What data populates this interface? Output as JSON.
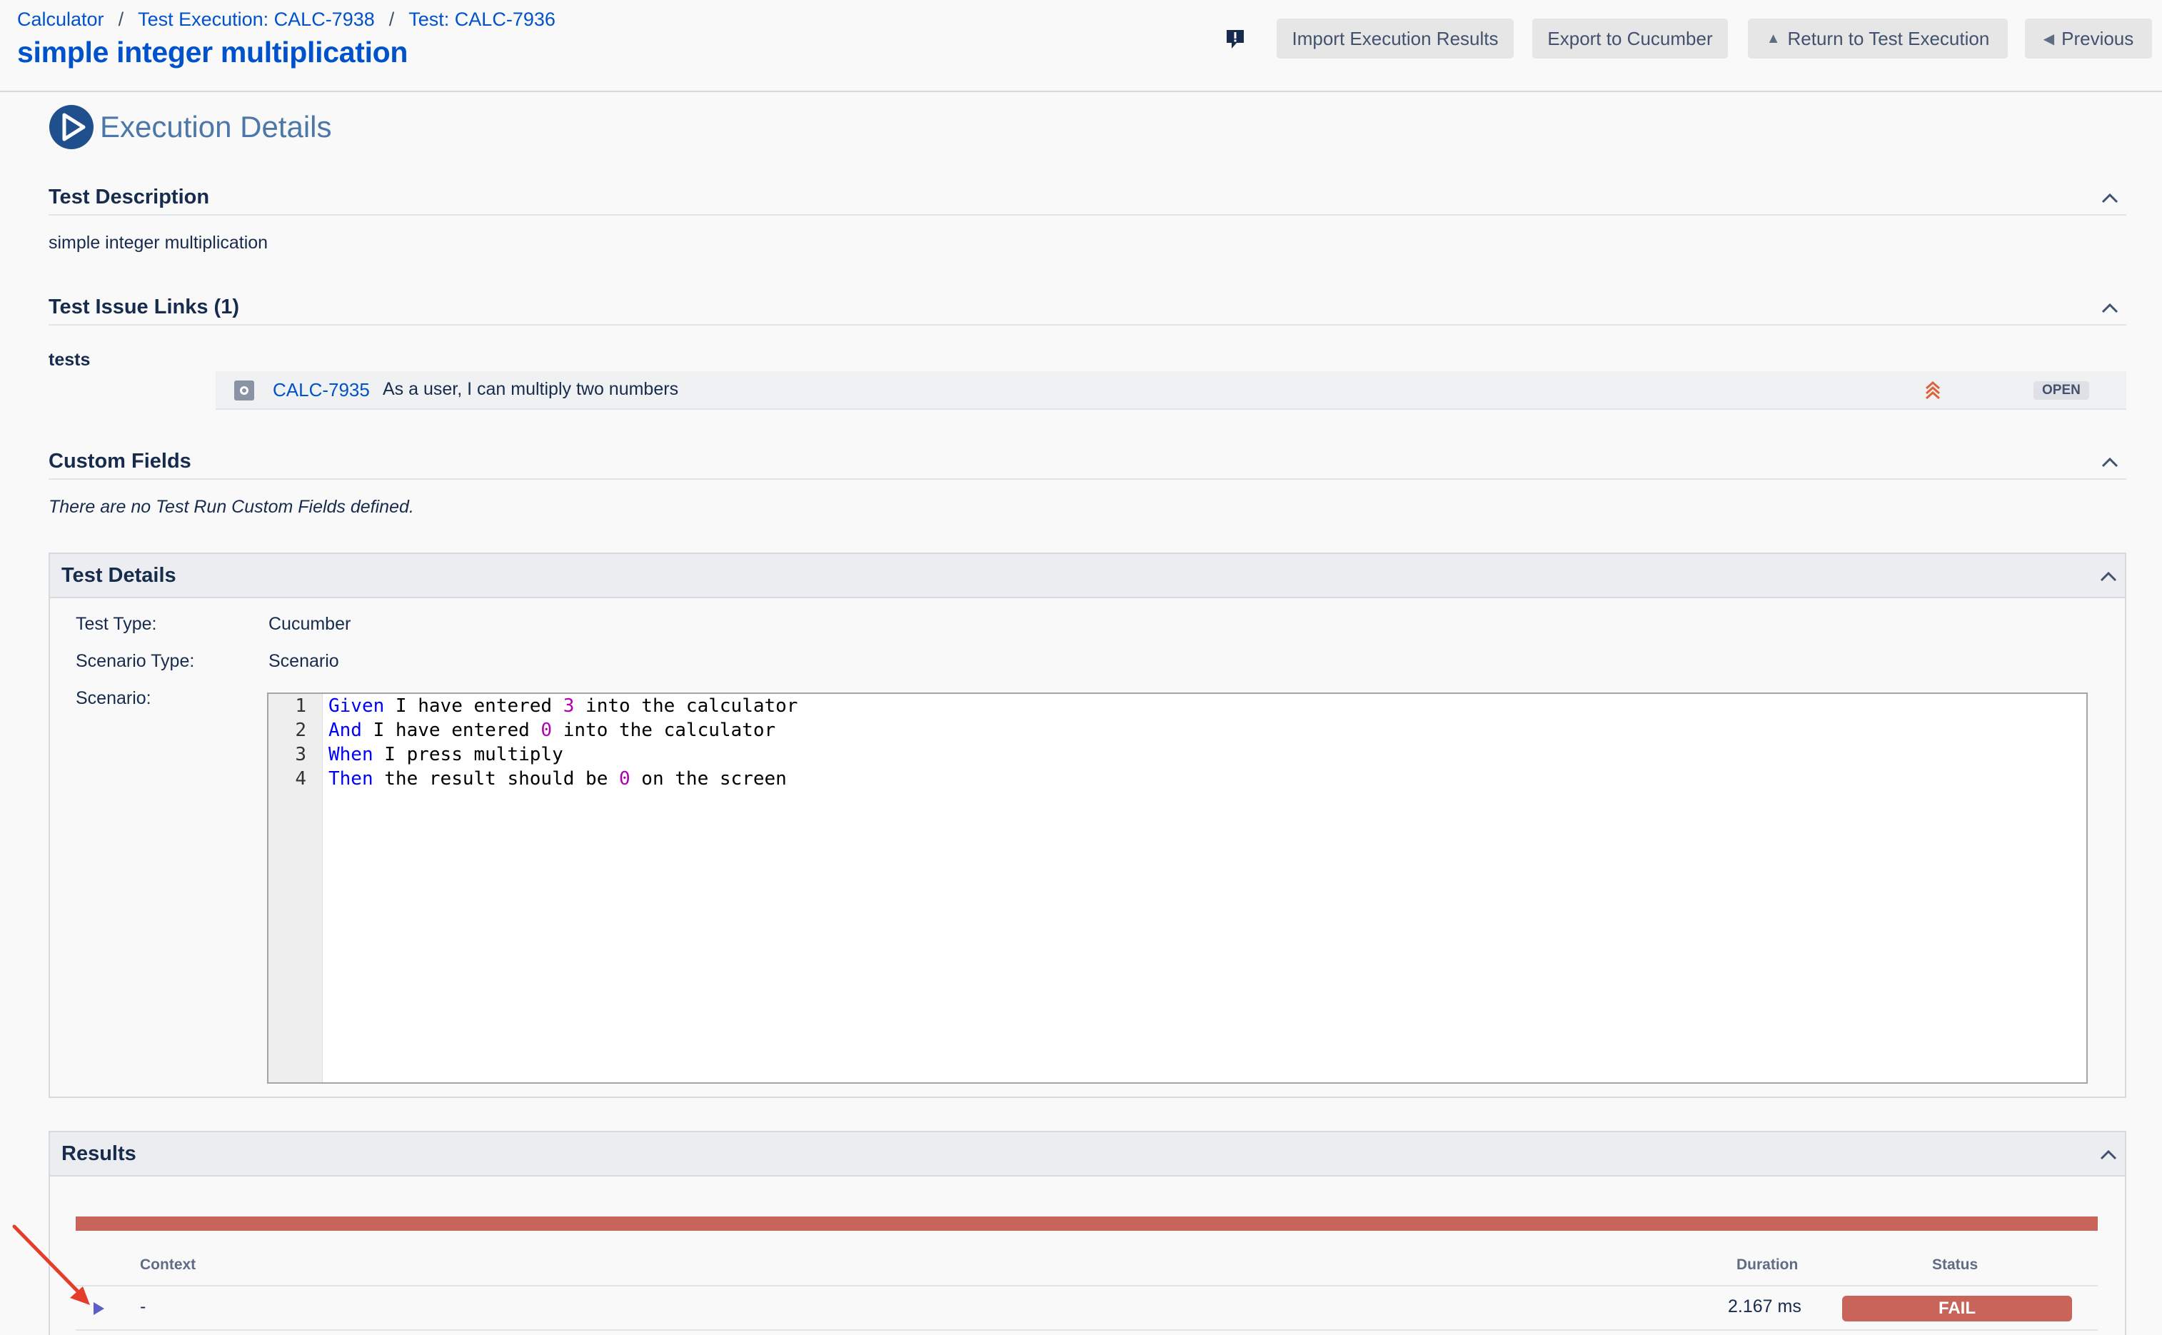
{
  "breadcrumb": [
    "Calculator",
    "Test Execution: CALC-7938",
    "Test: CALC-7936"
  ],
  "page_title": "simple integer multiplication",
  "toolbar": {
    "import": "Import Execution Results",
    "export": "Export to Cucumber",
    "return": "Return to Test Execution",
    "previous": "Previous"
  },
  "icons": {
    "feedback": "feedback-icon",
    "execution": "play-circle-icon",
    "collapse": "chevron-up-icon",
    "issue_type": "issue-type-icon",
    "priority": "priority-highest-icon",
    "expand": "play-triangle-icon"
  },
  "execution_title": "Execution Details",
  "sections": {
    "description": {
      "title": "Test Description",
      "text": "simple integer multiplication"
    },
    "issue_links": {
      "title": "Test Issue Links (1)",
      "relation": "tests",
      "items": [
        {
          "key": "CALC-7935",
          "summary": "As a user, I can multiply two numbers",
          "status": "OPEN"
        }
      ]
    },
    "custom_fields": {
      "title": "Custom Fields",
      "text": "There are no Test Run Custom Fields defined."
    }
  },
  "test_details": {
    "title": "Test Details",
    "test_type_label": "Test Type:",
    "test_type": "Cucumber",
    "scenario_type_label": "Scenario Type:",
    "scenario_type": "Scenario",
    "scenario_label": "Scenario:",
    "scenario_lines": [
      {
        "n": "1",
        "kw": "Given",
        "pre": " I have entered ",
        "num": "3",
        "post": " into the calculator"
      },
      {
        "n": "2",
        "kw": "And",
        "pre": " I have entered ",
        "num": "0",
        "post": " into the calculator"
      },
      {
        "n": "3",
        "kw": "When",
        "pre": " I press multiply",
        "num": "",
        "post": ""
      },
      {
        "n": "4",
        "kw": "Then",
        "pre": " the result should be ",
        "num": "0",
        "post": " on the screen"
      }
    ]
  },
  "results": {
    "title": "Results",
    "columns": {
      "context": "Context",
      "duration": "Duration",
      "status": "Status"
    },
    "rows": [
      {
        "context": "-",
        "duration": "2.167 ms",
        "status": "FAIL"
      }
    ]
  },
  "colors": {
    "link": "#0052cc",
    "fail": "#c9645a",
    "keyword": "#0000ff",
    "number": "#b000b0",
    "annotation_arrow": "#e53d2c"
  }
}
